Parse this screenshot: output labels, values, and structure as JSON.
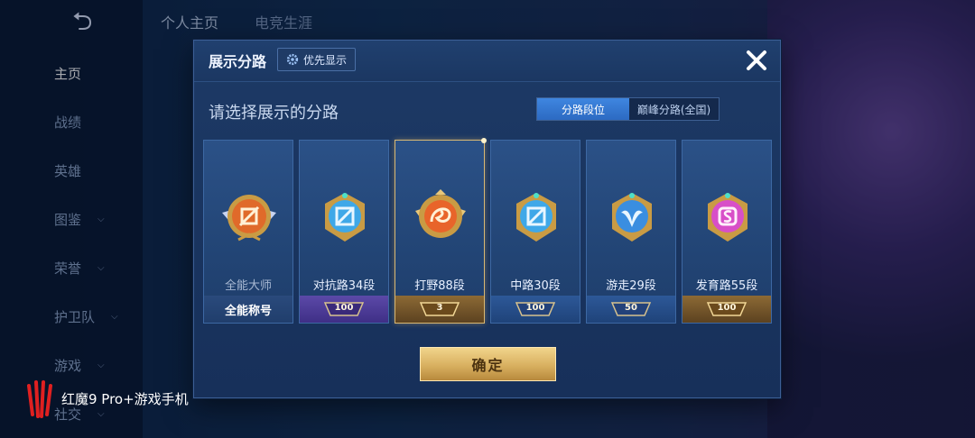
{
  "background": {
    "tabs": [
      "个人主页",
      "电竞生涯"
    ],
    "sidebar": [
      {
        "label": "主页",
        "chevron": false,
        "active": true
      },
      {
        "label": "战绩",
        "chevron": false
      },
      {
        "label": "英雄",
        "chevron": false
      },
      {
        "label": "图鉴",
        "chevron": true
      },
      {
        "label": "荣誉",
        "chevron": true
      },
      {
        "label": "护卫队",
        "chevron": true
      },
      {
        "label": "游戏",
        "chevron": true
      },
      {
        "label": "社交",
        "chevron": true
      }
    ]
  },
  "watermark": {
    "text": "红魔9 Pro+游戏手机"
  },
  "modal": {
    "title": "展示分路",
    "priority_button": "优先显示",
    "subtitle": "请选择展示的分路",
    "segments": {
      "active": "分路段位",
      "inactive": "巅峰分路(全国)"
    },
    "confirm_label": "确定",
    "cards": [
      {
        "label": "全能大师",
        "footer_text": "全能称号",
        "footer_style": "plain",
        "badge_color": "#e06a2a",
        "label_dim": true
      },
      {
        "label": "对抗路34段",
        "stars": "100",
        "footer_style": "purple",
        "badge_color": "#3fa8e8"
      },
      {
        "label": "打野88段",
        "stars": "3",
        "footer_style": "gold",
        "badge_color": "#e8642a",
        "selected": true
      },
      {
        "label": "中路30段",
        "stars": "100",
        "footer_style": "blue",
        "badge_color": "#3fa8e8"
      },
      {
        "label": "游走29段",
        "stars": "50",
        "footer_style": "blue",
        "badge_color": "#3a8ee0"
      },
      {
        "label": "发育路55段",
        "stars": "100",
        "footer_style": "gold",
        "badge_color": "#d84fc8"
      }
    ]
  },
  "colors": {
    "accent_gold": "#d9b873",
    "active_segment": "#3f86e0"
  }
}
